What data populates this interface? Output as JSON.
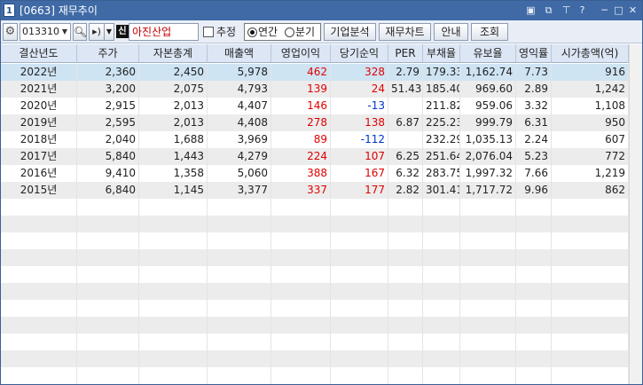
{
  "window": {
    "number": "1",
    "title": "[0663] 재무추이"
  },
  "toolbar": {
    "code_value": "013310",
    "market_badge": "신",
    "company_name": "아진산업",
    "estimate_label": "추정",
    "estimate_checked": false,
    "period_options": [
      "연간",
      "분기"
    ],
    "period_selected": "연간",
    "buttons": [
      "기업분석",
      "재무차트",
      "안내",
      "조회"
    ]
  },
  "table": {
    "columns": [
      "결산년도",
      "주가",
      "자본총계",
      "매출액",
      "영업이익",
      "당기순익",
      "PER",
      "부채율",
      "유보율",
      "영익률",
      "시가총액(억)"
    ],
    "rows": [
      {
        "year": "2022년",
        "price": "2,360",
        "equity": "2,450",
        "sales": "5,978",
        "op_income": "462",
        "net_income": "328",
        "per": "2.79",
        "debt_ratio": "179.33",
        "reserve_ratio": "1,162.74",
        "op_margin": "7.73",
        "market_cap": "916"
      },
      {
        "year": "2021년",
        "price": "3,200",
        "equity": "2,075",
        "sales": "4,793",
        "op_income": "139",
        "net_income": "24",
        "per": "51.43",
        "debt_ratio": "185.40",
        "reserve_ratio": "969.60",
        "op_margin": "2.89",
        "market_cap": "1,242"
      },
      {
        "year": "2020년",
        "price": "2,915",
        "equity": "2,013",
        "sales": "4,407",
        "op_income": "146",
        "net_income": "-13",
        "per": "",
        "debt_ratio": "211.82",
        "reserve_ratio": "959.06",
        "op_margin": "3.32",
        "market_cap": "1,108"
      },
      {
        "year": "2019년",
        "price": "2,595",
        "equity": "2,013",
        "sales": "4,408",
        "op_income": "278",
        "net_income": "138",
        "per": "6.87",
        "debt_ratio": "225.23",
        "reserve_ratio": "999.79",
        "op_margin": "6.31",
        "market_cap": "950"
      },
      {
        "year": "2018년",
        "price": "2,040",
        "equity": "1,688",
        "sales": "3,969",
        "op_income": "89",
        "net_income": "-112",
        "per": "",
        "debt_ratio": "232.29",
        "reserve_ratio": "1,035.13",
        "op_margin": "2.24",
        "market_cap": "607"
      },
      {
        "year": "2017년",
        "price": "5,840",
        "equity": "1,443",
        "sales": "4,279",
        "op_income": "224",
        "net_income": "107",
        "per": "6.25",
        "debt_ratio": "251.64",
        "reserve_ratio": "2,076.04",
        "op_margin": "5.23",
        "market_cap": "772"
      },
      {
        "year": "2016년",
        "price": "9,410",
        "equity": "1,358",
        "sales": "5,060",
        "op_income": "388",
        "net_income": "167",
        "per": "6.32",
        "debt_ratio": "283.75",
        "reserve_ratio": "1,997.32",
        "op_margin": "7.66",
        "market_cap": "1,219"
      },
      {
        "year": "2015년",
        "price": "6,840",
        "equity": "1,145",
        "sales": "3,377",
        "op_income": "337",
        "net_income": "177",
        "per": "2.82",
        "debt_ratio": "301.41",
        "reserve_ratio": "1,717.72",
        "op_margin": "9.96",
        "market_cap": "862"
      }
    ],
    "selected_row": 0
  },
  "colors": {
    "positive": "#e00000",
    "negative": "#0033cc",
    "header_bg": "#dce6f4",
    "selected_row_bg": "#cfe4f3",
    "titlebar_bg": "#3f6aa6"
  },
  "icons": {
    "settings": "gear-icon",
    "search": "search-icon",
    "sound": "speaker-icon",
    "window_controls": [
      "restore-icon",
      "copy-icon",
      "pin-icon",
      "help-icon",
      "minimize-icon",
      "maximize-icon",
      "close-icon"
    ]
  }
}
